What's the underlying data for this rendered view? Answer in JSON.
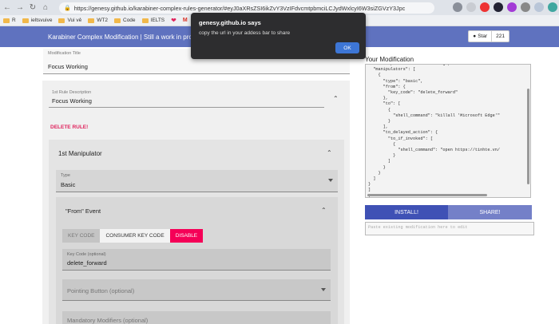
{
  "browser": {
    "url": "https://genesy.github.io/karabiner-complex-rules-generator/#eyJ0aXRsZSI6ikZvY3VzIFdvcmtpbmciLCJydWxlcyI6W3siZGVzY3Jpc",
    "bookmarks": [
      {
        "label": "R"
      },
      {
        "label": "ieltsvuive"
      },
      {
        "label": "Vui vẻ"
      },
      {
        "label": "WT2"
      },
      {
        "label": "Code"
      },
      {
        "label": "IELTS"
      }
    ]
  },
  "header": {
    "title": "Karabiner Complex Modification | Still a work in pro",
    "star_label": "Star",
    "star_count": "221"
  },
  "form": {
    "modification_title_label": "Modification Title",
    "modification_title_value": "Focus Working",
    "rule_desc_label": "1st Rule Description",
    "rule_desc_value": "Focus Working",
    "delete_rule": "DELETE RULE!",
    "manipulator_title": "1st Manipulator",
    "type_label": "Type",
    "type_value": "Basic",
    "from_title": "\"From\" Event",
    "btn_key_code": "KEY CODE",
    "btn_consumer_key_code": "CONSUMER KEY CODE",
    "btn_disable": "DISABLE",
    "key_code_label": "Key Code (optional)",
    "key_code_value": "delete_forward",
    "pointing_button": "Pointing Button (optional)",
    "mandatory_modifiers": "Mandatory Modifiers (optional)"
  },
  "output": {
    "heading": "Your Modification",
    "code": "  \"description\": \"Focus Working\",\n  \"manipulators\": [\n    {\n      \"type\": \"basic\",\n      \"from\": {\n        \"key_code\": \"delete_forward\"\n      },\n      \"to\": [\n        {\n          \"shell_command\": \"killall 'Microsoft Edge'\"\n        }\n      ],\n      \"to_delayed_action\": {\n        \"to_if_invoked\": [\n          {\n            \"shell_command\": \"open https://tinhte.vn/\n          }\n        ]\n      }\n    }\n  ]\n}\n]\n}",
    "install": "INSTALL!",
    "share": "SHARE!",
    "paste_placeholder": "Paste existing modification here to edit"
  },
  "dialog": {
    "title": "genesy.github.io says",
    "message": "copy the url in your addess bar to share",
    "ok": "OK"
  }
}
